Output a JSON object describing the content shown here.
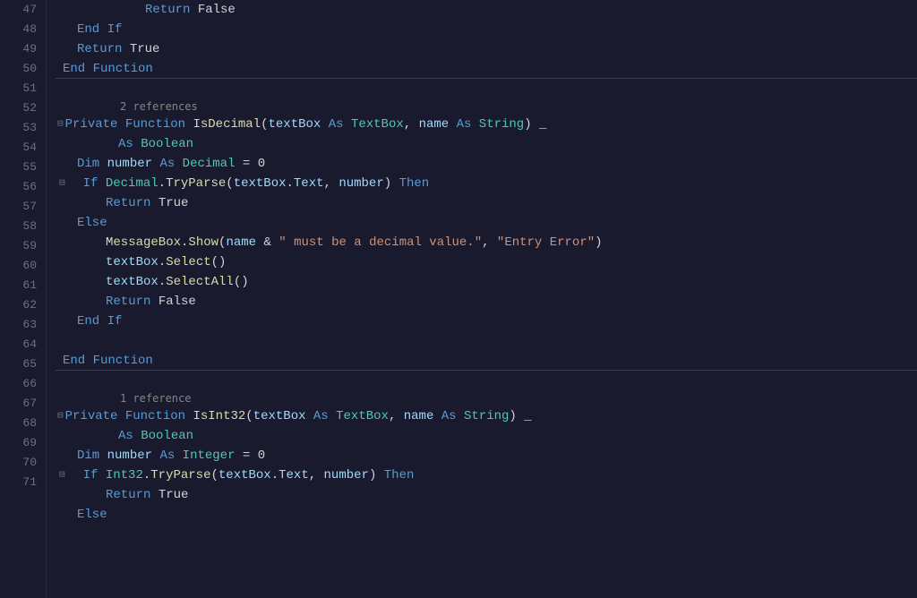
{
  "editor": {
    "theme": {
      "bg": "#1a1a2e",
      "line_num_color": "#6e7080",
      "separator_color": "#2d2d45"
    },
    "lines": [
      {
        "num": 47,
        "content": "return_false_1",
        "indent": 3
      },
      {
        "num": 48,
        "content": "end_if_1",
        "indent": 2
      },
      {
        "num": 49,
        "content": "return_true_1",
        "indent": 2
      },
      {
        "num": 50,
        "content": "end_function_1",
        "indent": 1,
        "separator": true
      },
      {
        "num": 51,
        "content": "empty",
        "indent": 0
      },
      {
        "num": 52,
        "content": "private_function_isdecimal",
        "indent": 1,
        "fold": true,
        "ref": "2 references"
      },
      {
        "num": 53,
        "content": "as_boolean_1",
        "indent": 3
      },
      {
        "num": 54,
        "content": "dim_number_decimal",
        "indent": 2
      },
      {
        "num": 55,
        "content": "if_decimal_tryparse",
        "indent": 2,
        "fold": true
      },
      {
        "num": 56,
        "content": "return_true_2",
        "indent": 3
      },
      {
        "num": 57,
        "content": "else_1",
        "indent": 2
      },
      {
        "num": 58,
        "content": "messagebox_show_decimal",
        "indent": 3
      },
      {
        "num": 59,
        "content": "textbox_select_1",
        "indent": 3
      },
      {
        "num": 60,
        "content": "textbox_selectall_1",
        "indent": 3
      },
      {
        "num": 61,
        "content": "return_false_2",
        "indent": 3
      },
      {
        "num": 62,
        "content": "end_if_2",
        "indent": 2
      },
      {
        "num": 63,
        "content": "empty2",
        "indent": 0
      },
      {
        "num": 64,
        "content": "end_function_2",
        "indent": 1,
        "separator": true
      },
      {
        "num": 65,
        "content": "empty3",
        "indent": 0
      },
      {
        "num": 66,
        "content": "private_function_isint32",
        "indent": 1,
        "fold": true,
        "ref": "1 reference"
      },
      {
        "num": 67,
        "content": "as_boolean_2",
        "indent": 3
      },
      {
        "num": 68,
        "content": "dim_number_integer",
        "indent": 2
      },
      {
        "num": 69,
        "content": "if_int32_tryparse",
        "indent": 2,
        "fold": true
      },
      {
        "num": 70,
        "content": "return_true_3",
        "indent": 3
      },
      {
        "num": 71,
        "content": "else_2",
        "indent": 2
      }
    ]
  }
}
